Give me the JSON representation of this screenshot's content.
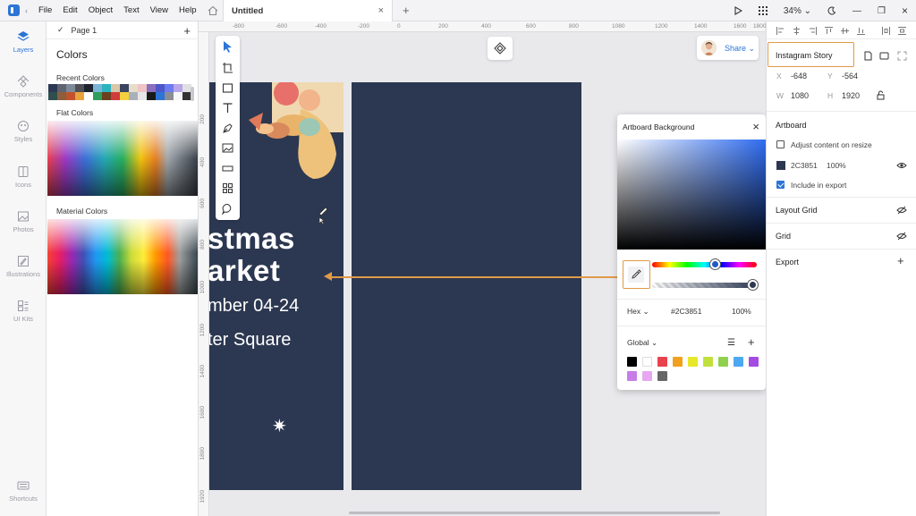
{
  "menu": [
    "File",
    "Edit",
    "Object",
    "Text",
    "View",
    "Help"
  ],
  "document": {
    "title": "Untitled"
  },
  "toolbar_right": {
    "zoom": "34%"
  },
  "rail": [
    {
      "label": "Layers",
      "icon": "layers-icon"
    },
    {
      "label": "Components",
      "icon": "components-icon"
    },
    {
      "label": "Styles",
      "icon": "styles-icon"
    },
    {
      "label": "Icons",
      "icon": "icons-icon"
    },
    {
      "label": "Photos",
      "icon": "photos-icon"
    },
    {
      "label": "Illustrations",
      "icon": "illustrations-icon"
    },
    {
      "label": "UI Kits",
      "icon": "ui-kits-icon"
    },
    {
      "label": "Shortcuts",
      "icon": "shortcuts-icon"
    }
  ],
  "colors_panel": {
    "page": "Page 1",
    "title": "Colors",
    "recent_label": "Recent Colors",
    "flat_label": "Flat Colors",
    "material_label": "Material Colors",
    "recent_colors": [
      "#2c3851",
      "#5e6470",
      "#7f8a98",
      "#4f4f57",
      "#1e2330",
      "#7bb6d8",
      "#2bb3c0",
      "#d9c7a7",
      "#3b4560",
      "#e8dccb",
      "#f0c4c4",
      "#8a6fbf",
      "#4e57c8",
      "#6d7cf0",
      "#b7a6e8",
      "#e0e0e3",
      "#2f4f4f",
      "#8b5e3c",
      "#c2522d",
      "#e8a33c",
      "#ffffff",
      "#2f9e5b",
      "#6c3f1e",
      "#d13b3b",
      "#f4d03f",
      "#aab0b8",
      "#e6e6e9",
      "#1a1a1a",
      "#2c74d6",
      "#8c8c94",
      "#f7f7f8",
      "#333333"
    ]
  },
  "rulers": {
    "top": [
      "-800",
      "-600",
      "-400",
      "-200",
      "0",
      "200",
      "400",
      "600",
      "800",
      "1080",
      "1200",
      "1400",
      "1600",
      "1800"
    ],
    "left": [
      "200",
      "400",
      "600",
      "800",
      "1000",
      "1200",
      "1400",
      "1600",
      "1800",
      "1920"
    ]
  },
  "canvas": {
    "title_line1": "stmas",
    "title_line2": "arket",
    "date_line": "mber 04-24",
    "place_line": "ter Square",
    "share_label": "Share"
  },
  "picker": {
    "title": "Artboard Background",
    "mode": "Hex",
    "hex": "#2C3851",
    "opacity": "100%",
    "palette_label": "Global",
    "swatches": [
      "#000000",
      "#ffffff",
      "#e8424d",
      "#f0a21e",
      "#e8e82a",
      "#c2e03c",
      "#8fd14f",
      "#4da8f2",
      "#a44ce0",
      "#c87ce8",
      "#e8a6f0",
      "#666666"
    ]
  },
  "inspector": {
    "artboard_name": "Instagram Story",
    "x_label": "X",
    "x": "-648",
    "y_label": "Y",
    "y": "-564",
    "w_label": "W",
    "w": "1080",
    "h_label": "H",
    "h": "1920",
    "artboard_heading": "Artboard",
    "adjust_label": "Adjust content on resize",
    "fill_hex": "2C3851",
    "fill_opacity": "100%",
    "fill_color": "#2c3851",
    "include_label": "Include in export",
    "layout_grid": "Layout Grid",
    "grid": "Grid",
    "export": "Export"
  }
}
